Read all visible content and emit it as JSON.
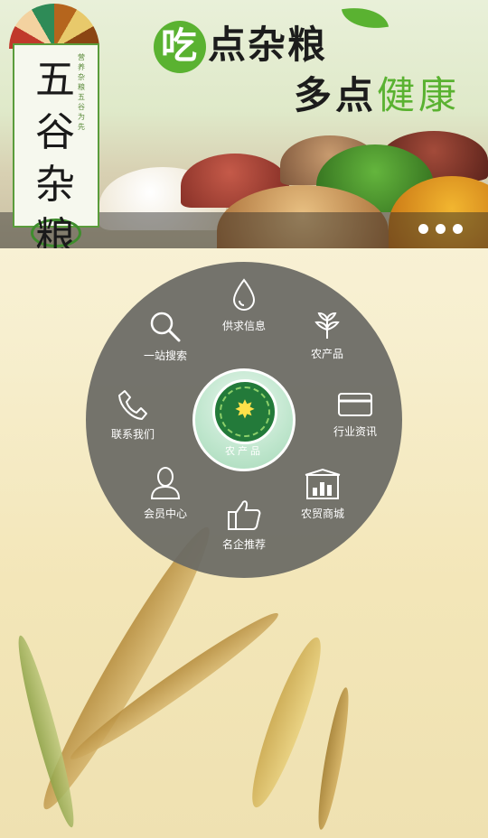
{
  "banner": {
    "logo_big": "五谷杂粮",
    "logo_small": "营养杂粮五谷为先",
    "slogan_line1_first": "吃",
    "slogan_line1_rest": "点杂粮",
    "slogan_line2_a": "多点",
    "slogan_line2_b": "健康",
    "carousel_indicators": 3
  },
  "menu": {
    "center_label": "农产品",
    "items": [
      {
        "id": "supply",
        "label": "供求信息",
        "icon": "water-drop-icon"
      },
      {
        "id": "products",
        "label": "农产品",
        "icon": "sprout-icon"
      },
      {
        "id": "news",
        "label": "行业资讯",
        "icon": "card-icon"
      },
      {
        "id": "mall",
        "label": "农贸商城",
        "icon": "store-chart-icon"
      },
      {
        "id": "recommend",
        "label": "名企推荐",
        "icon": "thumbs-up-icon"
      },
      {
        "id": "member",
        "label": "会员中心",
        "icon": "user-icon"
      },
      {
        "id": "contact",
        "label": "联系我们",
        "icon": "phone-icon"
      },
      {
        "id": "search",
        "label": "一站搜索",
        "icon": "search-icon"
      }
    ]
  },
  "colors": {
    "accent_green": "#5ab231",
    "wheel_gray": "#696964"
  }
}
